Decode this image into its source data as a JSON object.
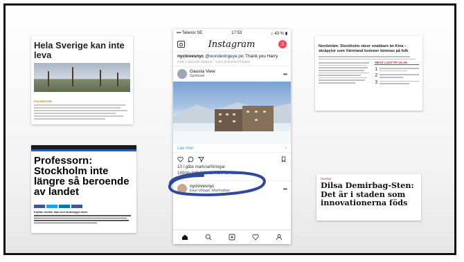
{
  "card_left_top": {
    "headline": "Hela Sverige kan inte leva",
    "tag": "FOLKBIOTEK"
  },
  "card_left_bottom": {
    "headline": "Professorn: Stockholm inte längre så beroende av landet",
    "intro": "Klyftan mellan stad och landsbygd växer."
  },
  "card_right_top": {
    "headline": "Nordsträm: Stockholm växer snabbare än Kina – skräpytor som Värmland kommer tömmas på folk",
    "most_read_label": "MEST LAST PA VA.SE",
    "numbers": [
      "1",
      "2",
      "3"
    ]
  },
  "card_right_bottom": {
    "section": "Sverige",
    "headline": "Dilsa Demirbag-Sten: Det är i staden som innovationerna föds"
  },
  "phone": {
    "status": {
      "carrier": "Telenor SE",
      "time": "17:53",
      "battery": "43 %"
    },
    "header": {
      "title": "Instagram",
      "badge": "3"
    },
    "comment": {
      "user": "nyclovesnyc",
      "mention": "@wonderingeye.pic",
      "text": " Thank you Harry",
      "translate": "FÖR 2 DAGAR SEDAN · VISA ÖVERSÄTTNING"
    },
    "sponsored_post": {
      "name": "Gausta View",
      "sub": "Sponrad"
    },
    "cta": "Läs mer",
    "caption_line1": "10 i gåta marknarföringar",
    "caption_line2": "1650m fallhöjd, närmare än Sälen.",
    "next_post": {
      "name": "nyclovesnyc",
      "sub": "East Village, Manhattan"
    }
  },
  "colors": {
    "instagram_badge": "#ed4956",
    "link_blue": "#3897f0",
    "scribble": "#2f4a9a",
    "accent_red": "#c9302c"
  }
}
